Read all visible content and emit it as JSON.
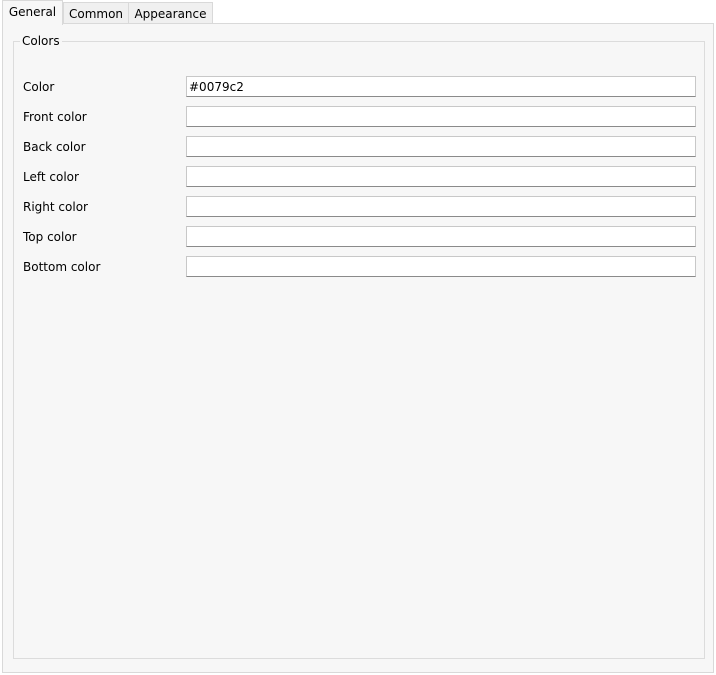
{
  "tabs": [
    {
      "label": "General",
      "active": true
    },
    {
      "label": "Common",
      "active": false
    },
    {
      "label": "Appearance",
      "active": false
    }
  ],
  "group": {
    "title": "Colors",
    "rows": [
      {
        "label": "Color",
        "value": "#0079c2"
      },
      {
        "label": "Front color",
        "value": ""
      },
      {
        "label": "Back color",
        "value": ""
      },
      {
        "label": "Left color",
        "value": ""
      },
      {
        "label": "Right color",
        "value": ""
      },
      {
        "label": "Top color",
        "value": ""
      },
      {
        "label": "Bottom color",
        "value": ""
      }
    ]
  }
}
